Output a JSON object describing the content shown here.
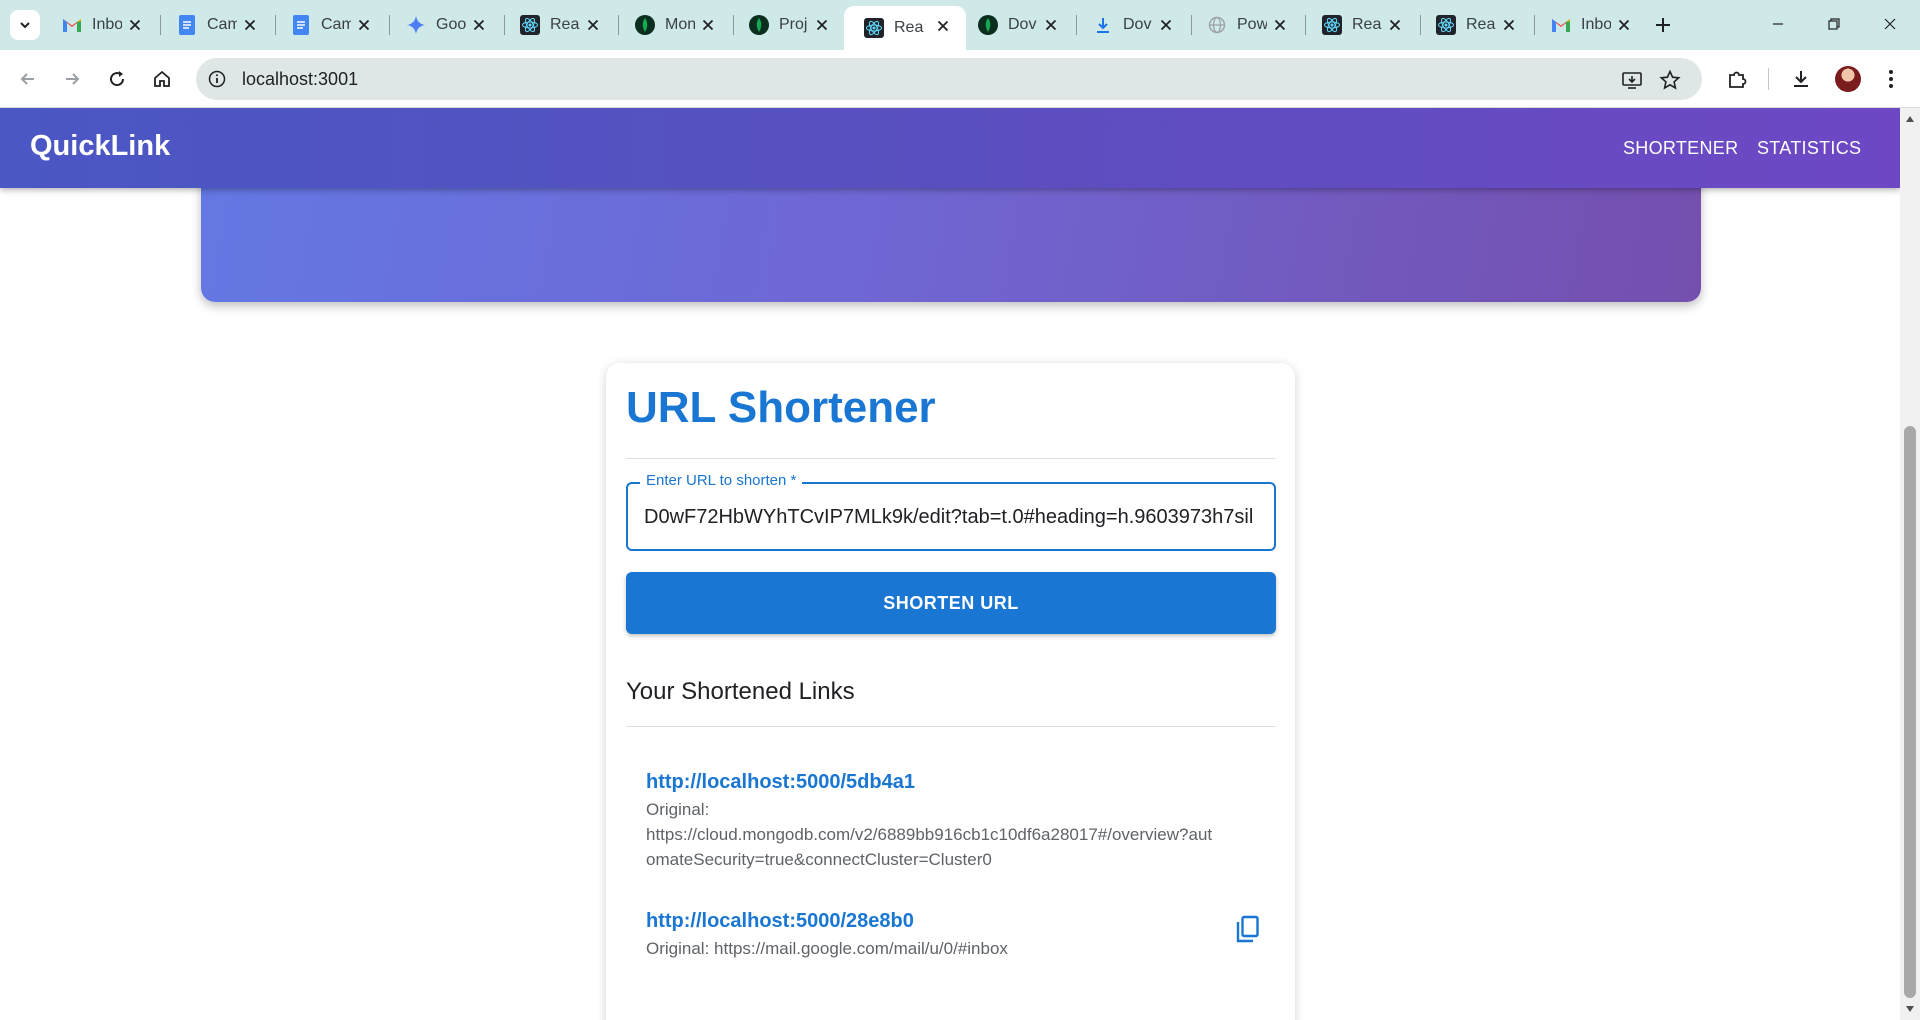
{
  "browser": {
    "tabs": [
      {
        "title": "Inbox",
        "icon": "gmail-icon"
      },
      {
        "title": "Cam",
        "icon": "docs-icon"
      },
      {
        "title": "Cam",
        "icon": "docs-icon"
      },
      {
        "title": "Goo",
        "icon": "gemini-icon"
      },
      {
        "title": "Rea",
        "icon": "react-icon"
      },
      {
        "title": "Mon",
        "icon": "mongodb-icon"
      },
      {
        "title": "Proj",
        "icon": "mongodb-icon"
      },
      {
        "title": "Rea",
        "icon": "react-icon",
        "active": true
      },
      {
        "title": "Dov",
        "icon": "mongodb-icon"
      },
      {
        "title": "Dov",
        "icon": "download-icon"
      },
      {
        "title": "Pow",
        "icon": "globe-icon"
      },
      {
        "title": "Rea",
        "icon": "react-icon"
      },
      {
        "title": "Rea",
        "icon": "react-icon"
      },
      {
        "title": "Inbox",
        "icon": "gmail-icon"
      }
    ],
    "address": "localhost:3001"
  },
  "appbar": {
    "brand": "QuickLink",
    "nav": [
      "SHORTENER",
      "STATISTICS"
    ]
  },
  "card": {
    "title": "URL Shortener",
    "input_label": "Enter URL to shorten *",
    "input_value": "D0wF72HbWYhTCvIP7MLk9k/edit?tab=t.0#heading=h.9603973h7sil",
    "button_label": "SHORTEN URL",
    "section_title": "Your Shortened Links",
    "links": [
      {
        "short": "http://localhost:5000/5db4a1",
        "original_prefix": "Original:",
        "original": "https://cloud.mongodb.com/v2/6889bb916cb1c10df6a28017#/overview?automateSecurity=true&connectCluster=Cluster0"
      },
      {
        "short": "http://localhost:5000/28e8b0",
        "original_prefix": "Original:",
        "original": "https://mail.google.com/mail/u/0/#inbox"
      }
    ]
  },
  "colors": {
    "primary": "#1976d2",
    "accent_orange": "#e8720c"
  }
}
